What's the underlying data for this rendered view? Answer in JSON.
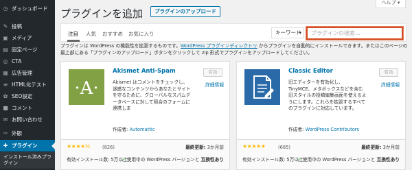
{
  "sidebar": {
    "items": [
      {
        "label": "ダッシュボード",
        "icon": "dashboard-icon",
        "glyph": "◷"
      },
      {
        "label": "投稿",
        "icon": "pin-icon",
        "glyph": "✎"
      },
      {
        "label": "メディア",
        "icon": "media-icon",
        "glyph": "▣"
      },
      {
        "label": "固定ページ",
        "icon": "page-icon",
        "glyph": "▤"
      },
      {
        "label": "CTA",
        "icon": "cta-icon",
        "glyph": "◎"
      },
      {
        "label": "広告管理",
        "icon": "ad-icon",
        "glyph": "▦"
      },
      {
        "label": "HTML化テスト",
        "icon": "code-icon",
        "glyph": "≡"
      },
      {
        "label": "SEO設定",
        "icon": "seo-icon",
        "glyph": "✿"
      },
      {
        "label": "コメント",
        "icon": "comment-icon",
        "glyph": "■"
      },
      {
        "label": "お問い合わせ",
        "icon": "mail-icon",
        "glyph": "✉"
      },
      {
        "label": "外観",
        "icon": "appearance-icon",
        "glyph": "✑"
      },
      {
        "label": "プラグイン",
        "icon": "plugin-icon",
        "glyph": "✚"
      }
    ],
    "sub_item": "インストール済みプラグイン"
  },
  "header": {
    "title": "プラグインを追加",
    "upload_label": "プラグインのアップロード",
    "help_label": "ヘルプ ▾"
  },
  "filter": {
    "tabs": [
      "注目",
      "人気",
      "おすすめ",
      "お気に入り"
    ],
    "select_value": "キーワード",
    "search_placeholder": "プラグインの検索..."
  },
  "description": {
    "part1": "プラグインは WordPress の機能性を拡張するものです。",
    "link": "WordPress プラグインディレクトリ",
    "part2": " からプラグインを自動的にインストールできます。またはこのページの最上部にある「プラグインのアップロード」ボタンをクリックして zip 形式でプラグインをアップロードしてください。"
  },
  "cards": [
    {
      "name": "Akismet Anti-Spam",
      "button": "有効",
      "details": "詳細情報",
      "desc": "Akismet はコメントをチェックし、迷惑なコンテンツからあなたとサイトを守るために、グローバルなスパムデータベースに対して照合のフォームに連携しま",
      "author_label": "作成者: ",
      "author": "Automattic",
      "stars": "★★★★½",
      "rating_count": "(826)",
      "installs": "有効インストール数: 5万以上",
      "updated_label": "最終更新:",
      "updated_value": "3か月前",
      "compat_text": "使用中の WordPress バージョンと",
      "compat_bold": "互換性あり",
      "icon_letter": "·A·",
      "icon_bg": "#82a044"
    },
    {
      "name": "Classic Editor",
      "button": "有効",
      "details": "詳細情報",
      "desc": "旧エディターを有効化し、TinyMCE、メタボックスなどを含む旧スタイルの投稿編集画面を使えるようにします。これらを拡張するすべてのプラグインに対応しています。",
      "author_label": "作成者: ",
      "author": "WordPress Contributors",
      "stars": "★★★★★",
      "rating_count": "(685)",
      "installs": "有効インストール数: 5万以上",
      "updated_label": "最終更新:",
      "updated_value": "3か月前",
      "compat_text": "使用中の WordPress バージョンと",
      "compat_bold": "互換性あり",
      "icon_bg": "#2a6aa8"
    }
  ]
}
